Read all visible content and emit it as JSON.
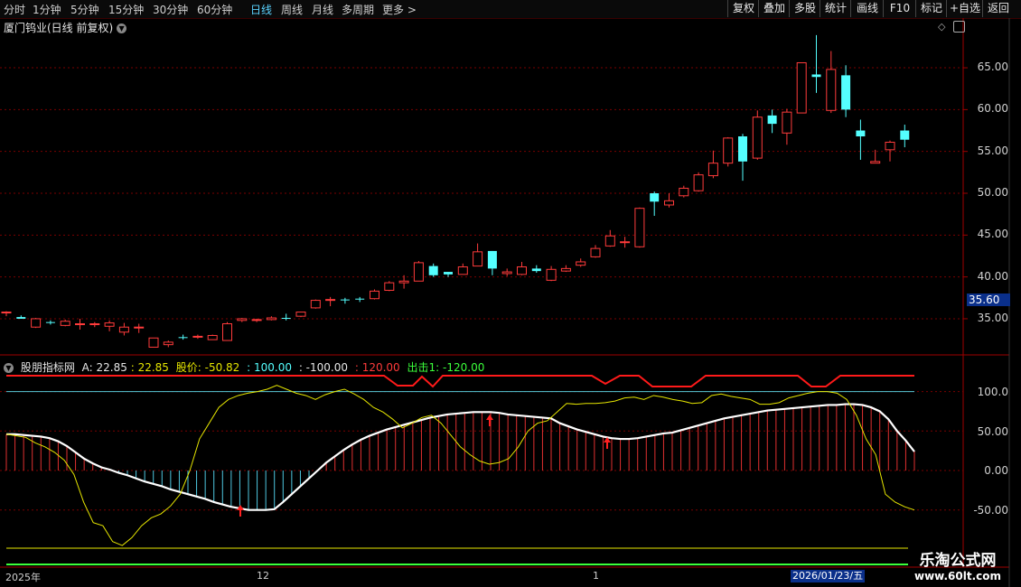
{
  "toolbar": {
    "periods": [
      "分时",
      "1分钟",
      "5分钟",
      "15分钟",
      "30分钟",
      "60分钟",
      "日线",
      "周线",
      "月线",
      "多周期",
      "更多 >"
    ],
    "active_period": "日线",
    "right_buttons": [
      "复权",
      "叠加",
      "多股",
      "统计",
      "画线",
      "F10",
      "标记",
      "+自选",
      "返回"
    ]
  },
  "chart_title": "厦门钨业(日线 前复权)",
  "price_axis": [
    "65.00",
    "60.00",
    "55.00",
    "50.00",
    "45.00",
    "40.00",
    "35.00"
  ],
  "current_price_label": "35.60",
  "indicator": {
    "name": "股朋指标网",
    "a_label": "A: 22.85",
    "a_value": ": 22.85",
    "stock_price": "股价: -50.82",
    "v100": ": 100.00",
    "vneg100": ": -100.00",
    "v120": ": 120.00",
    "exit_label": "出击1: -120.00"
  },
  "indicator_axis": [
    "100.0",
    "50.00",
    "0.00",
    "-50.00"
  ],
  "x_axis": {
    "labels": [
      "2025年",
      "12",
      "1"
    ],
    "current_date": "2026/01/23/五"
  },
  "watermark": {
    "title": "乐淘公式网",
    "url": "www.60lt.com"
  },
  "colors": {
    "up": "#ff3b3b",
    "down": "#54ffff",
    "grid": "#7a0000",
    "white_line": "#ffffff",
    "yellow_line": "#e6e600"
  },
  "chart_data": {
    "type": "candlestick",
    "ylim": [
      31,
      69
    ],
    "candles": [
      [
        35.7,
        35.9,
        35.3,
        35.8
      ],
      [
        35.2,
        35.4,
        35.0,
        35.0
      ],
      [
        34.0,
        35.1,
        33.9,
        35.0
      ],
      [
        34.6,
        34.8,
        34.3,
        34.5
      ],
      [
        34.2,
        34.9,
        34.1,
        34.7
      ],
      [
        34.3,
        35.0,
        33.7,
        34.4
      ],
      [
        34.3,
        34.6,
        34.0,
        34.4
      ],
      [
        34.1,
        34.8,
        33.5,
        34.5
      ],
      [
        33.4,
        34.5,
        33.0,
        34.0
      ],
      [
        33.9,
        34.4,
        33.3,
        34.0
      ],
      [
        31.6,
        32.7,
        31.6,
        32.7
      ],
      [
        31.9,
        32.4,
        31.6,
        32.2
      ],
      [
        32.8,
        33.1,
        32.5,
        32.7
      ],
      [
        32.8,
        33.1,
        32.6,
        32.9
      ],
      [
        32.5,
        33.1,
        32.5,
        33.0
      ],
      [
        32.4,
        34.6,
        32.4,
        34.4
      ],
      [
        34.8,
        35.1,
        34.6,
        35.0
      ],
      [
        34.8,
        35.0,
        34.6,
        34.9
      ],
      [
        34.9,
        35.3,
        34.8,
        35.1
      ],
      [
        35.1,
        35.6,
        34.8,
        35.0
      ],
      [
        35.3,
        35.8,
        35.2,
        35.8
      ],
      [
        36.3,
        37.3,
        36.2,
        37.2
      ],
      [
        37.2,
        37.6,
        36.5,
        37.3
      ],
      [
        37.3,
        37.5,
        36.8,
        37.2
      ],
      [
        37.4,
        37.6,
        37.0,
        37.3
      ],
      [
        37.4,
        38.5,
        37.3,
        38.3
      ],
      [
        38.4,
        39.5,
        38.3,
        39.3
      ],
      [
        39.3,
        40.2,
        38.6,
        39.5
      ],
      [
        39.5,
        41.9,
        39.5,
        41.7
      ],
      [
        41.3,
        41.6,
        40.0,
        40.2
      ],
      [
        40.6,
        40.6,
        40.0,
        40.3
      ],
      [
        40.3,
        41.6,
        40.3,
        41.2
      ],
      [
        41.3,
        44.0,
        41.3,
        43.0
      ],
      [
        43.1,
        43.1,
        40.2,
        41.0
      ],
      [
        40.4,
        41.0,
        40.1,
        40.6
      ],
      [
        40.3,
        41.8,
        40.2,
        41.2
      ],
      [
        41.0,
        41.4,
        40.5,
        40.7
      ],
      [
        39.6,
        41.3,
        39.5,
        40.9
      ],
      [
        40.7,
        41.4,
        40.6,
        41.0
      ],
      [
        41.4,
        42.2,
        41.2,
        41.8
      ],
      [
        42.4,
        43.8,
        42.3,
        43.4
      ],
      [
        43.7,
        45.6,
        43.6,
        44.9
      ],
      [
        44.2,
        44.8,
        43.5,
        44.2
      ],
      [
        43.6,
        48.3,
        43.5,
        48.2
      ],
      [
        50.0,
        50.2,
        47.3,
        49.0
      ],
      [
        48.6,
        50.0,
        48.3,
        49.1
      ],
      [
        49.7,
        50.9,
        49.5,
        50.6
      ],
      [
        50.3,
        52.5,
        50.2,
        52.2
      ],
      [
        52.1,
        55.1,
        51.8,
        53.6
      ],
      [
        53.6,
        56.7,
        53.2,
        56.6
      ],
      [
        56.8,
        57.1,
        51.5,
        53.8
      ],
      [
        54.2,
        59.9,
        54.0,
        59.1
      ],
      [
        59.3,
        60.0,
        57.2,
        58.3
      ],
      [
        57.2,
        60.1,
        55.8,
        59.7
      ],
      [
        59.6,
        65.6,
        59.6,
        65.6
      ],
      [
        64.2,
        68.9,
        62.0,
        63.9
      ],
      [
        59.9,
        67.0,
        59.6,
        64.8
      ],
      [
        64.1,
        65.3,
        59.1,
        60.0
      ],
      [
        57.5,
        58.8,
        54.0,
        56.8
      ],
      [
        53.6,
        55.2,
        53.6,
        53.8
      ],
      [
        55.2,
        56.3,
        53.8,
        56.1
      ],
      [
        57.5,
        58.2,
        55.5,
        56.4
      ]
    ],
    "indicator_white": [
      46,
      46,
      45,
      44,
      43,
      41,
      37,
      31,
      23,
      15,
      9,
      4,
      1,
      -3,
      -6,
      -10,
      -14,
      -17,
      -20,
      -24,
      -27,
      -30,
      -33,
      -36,
      -40,
      -43,
      -46,
      -48,
      -50,
      -50,
      -50,
      -49,
      -40,
      -30,
      -20,
      -10,
      0,
      10,
      18,
      26,
      33,
      39,
      44,
      48,
      52,
      55,
      58,
      61,
      64,
      67,
      69,
      71,
      72,
      73,
      74,
      74,
      74,
      73,
      71,
      70,
      69,
      68,
      67,
      66,
      60,
      56,
      52,
      49,
      46,
      43,
      41,
      40,
      40,
      41,
      43,
      45,
      47,
      48,
      51,
      54,
      57,
      60,
      63,
      66,
      68,
      70,
      72,
      74,
      76,
      77,
      78,
      79,
      80,
      81,
      82,
      83,
      83,
      84,
      84,
      83,
      80,
      75,
      65,
      50,
      38,
      24
    ],
    "indicator_yellow": [
      46,
      44,
      42,
      35,
      30,
      23,
      13,
      -5,
      -40,
      -66,
      -70,
      -90,
      -95,
      -85,
      -70,
      -60,
      -55,
      -45,
      -30,
      0,
      40,
      60,
      80,
      90,
      95,
      98,
      100,
      103,
      108,
      103,
      98,
      95,
      90,
      96,
      100,
      103,
      97,
      90,
      80,
      74,
      65,
      54,
      60,
      67,
      70,
      60,
      45,
      30,
      20,
      12,
      8,
      10,
      15,
      30,
      50,
      60,
      63,
      74,
      85,
      84,
      85,
      85,
      86,
      88,
      92,
      93,
      90,
      95,
      93,
      90,
      88,
      85,
      86,
      95,
      97,
      94,
      92,
      90,
      84,
      84,
      86,
      92,
      95,
      98,
      100,
      100,
      98,
      90,
      70,
      40,
      20,
      -30,
      -40,
      -46,
      -50
    ],
    "arrows_x_index": [
      15,
      31,
      38
    ],
    "series": [
      {
        "name": "A",
        "value": 22.85
      },
      {
        "name": "股价",
        "value": -50.82
      },
      {
        "name": "出击1",
        "value": -120.0
      }
    ]
  }
}
